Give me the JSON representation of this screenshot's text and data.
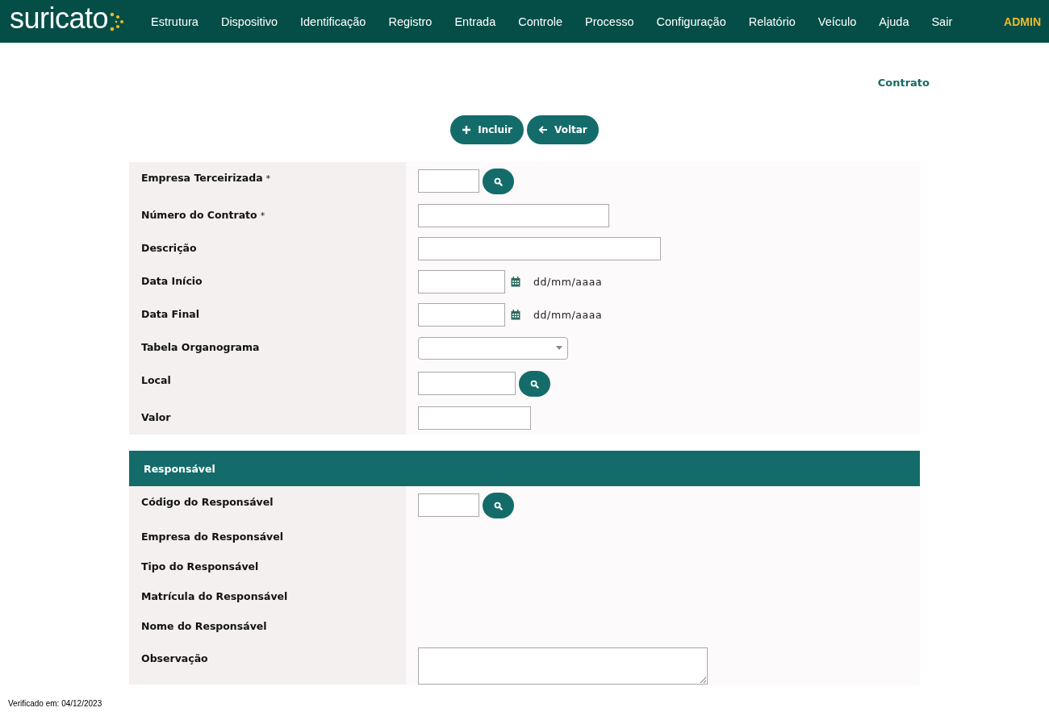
{
  "navbar": {
    "logo": "suricato",
    "menu": [
      {
        "label": "Estrutura"
      },
      {
        "label": "Dispositivo"
      },
      {
        "label": "Identificação"
      },
      {
        "label": "Registro"
      },
      {
        "label": "Entrada"
      },
      {
        "label": "Controle"
      },
      {
        "label": "Processo"
      },
      {
        "label": "Configuração"
      },
      {
        "label": "Relatório"
      },
      {
        "label": "Veículo"
      },
      {
        "label": "Ajuda"
      },
      {
        "label": "Sair"
      }
    ],
    "user": "ADMIN"
  },
  "page_title": "Contrato",
  "actions": [
    {
      "kind": "add",
      "label": "Incluir"
    },
    {
      "kind": "back",
      "label": "Voltar"
    }
  ],
  "sections": [
    {
      "fields": [
        {
          "label": "Empresa Terceirizada",
          "marker": "*",
          "kind": "lookup"
        },
        {
          "label": "Número do Contrato",
          "marker": "*",
          "kind": "text"
        },
        {
          "label": "Descrição",
          "kind": "text"
        },
        {
          "label": "Data Início",
          "kind": "date",
          "hint": "dd/mm/aaaa"
        },
        {
          "label": "Data Final",
          "kind": "date",
          "hint": "dd/mm/aaaa"
        },
        {
          "label": "Tabela Organograma",
          "kind": "select"
        },
        {
          "label": "Local",
          "kind": "lookup"
        },
        {
          "label": "Valor",
          "kind": "text"
        }
      ]
    },
    {
      "title": "Responsável",
      "fields": [
        {
          "label": "Código do Responsável",
          "kind": "lookup"
        },
        {
          "label": "Empresa do Responsável",
          "kind": "readonly"
        },
        {
          "label": "Tipo do Responsável",
          "kind": "readonly"
        },
        {
          "label": "Matrícula do Responsável",
          "kind": "readonly"
        },
        {
          "label": "Nome do Responsável",
          "kind": "readonly"
        },
        {
          "label": "Observação",
          "kind": "textarea"
        }
      ]
    }
  ],
  "footer": "Verificado em: 04/12/2023"
}
